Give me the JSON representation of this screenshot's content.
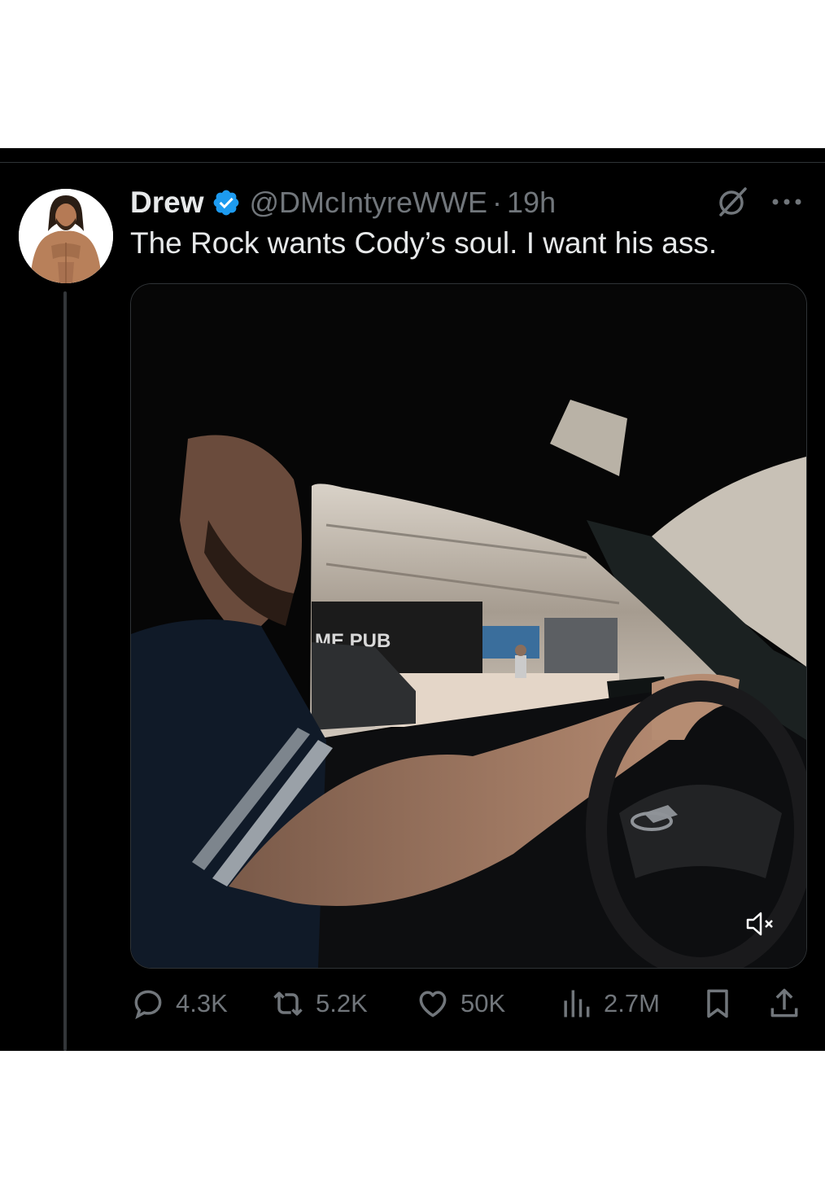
{
  "tweet": {
    "display_name": "Drew",
    "handle": "@DMcIntyreWWE",
    "separator": "·",
    "time": "19h",
    "text": "The Rock wants Cody’s soul. I want his ass.",
    "verified_color": "#1d9bf0"
  },
  "media": {
    "type": "video",
    "muted": true,
    "sign_text": "ME PUB"
  },
  "actions": {
    "replies": "4.3K",
    "reposts": "5.2K",
    "likes": "50K",
    "views": "2.7M"
  },
  "icons": {
    "reply": "speech-bubble",
    "repost": "repost-arrows",
    "like": "heart-outline",
    "views": "bar-chart",
    "bookmark": "bookmark-outline",
    "share": "upload-arrow",
    "grok": "grok-slash-circle",
    "more": "three-dots",
    "mute": "speaker-muted"
  },
  "colors": {
    "background": "#000000",
    "primary_text": "#e7e9ea",
    "secondary_text": "#71767b",
    "accent": "#1d9bf0"
  }
}
